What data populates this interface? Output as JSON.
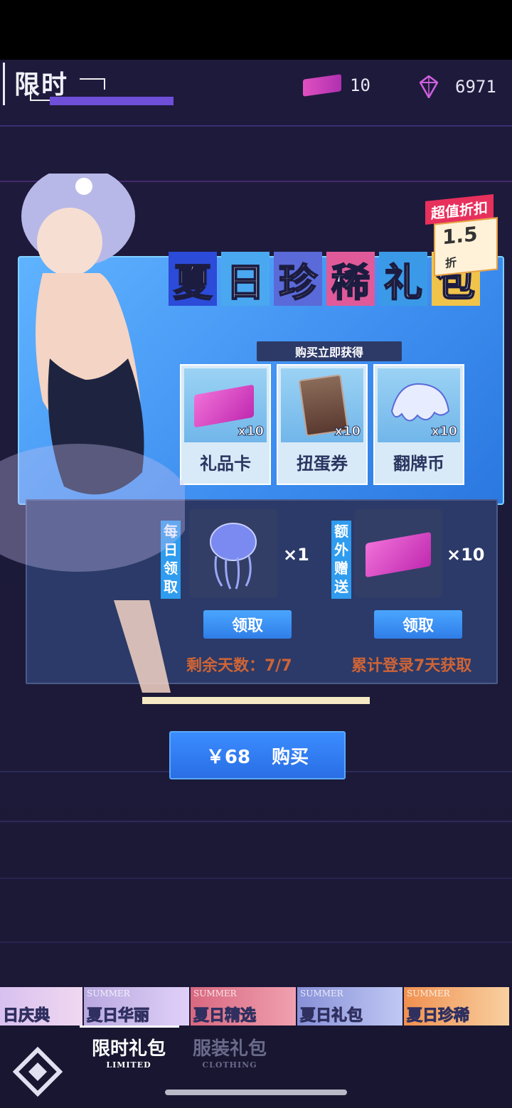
{
  "header": {
    "title": "限时",
    "currencies": [
      {
        "icon": "gift-card-icon",
        "value": "10"
      },
      {
        "icon": "crystal-icon",
        "value": "6971"
      }
    ]
  },
  "promo": {
    "discount_label": "超值折扣",
    "discount_value": "1.5",
    "discount_unit": "折"
  },
  "package": {
    "title_chars": [
      "夏",
      "日",
      "珍",
      "稀",
      "礼",
      "包"
    ],
    "title_colors": [
      "#2b4bd8",
      "#4aa8f0",
      "#5a6ad8",
      "#e05a9a",
      "#3a9ae8",
      "#f0c34a"
    ],
    "subtitle": "购买立即获得",
    "items": [
      {
        "name": "礼品卡",
        "qty": "x10",
        "icon": "gift-card-icon"
      },
      {
        "name": "扭蛋券",
        "qty": "x10",
        "icon": "gacha-ticket-icon"
      },
      {
        "name": "翻牌币",
        "qty": "x10",
        "icon": "flip-coin-creature-icon"
      }
    ]
  },
  "daily": {
    "tag": "每日领取",
    "qty": "×1",
    "icon": "jellyfish-icon",
    "claim_label": "领取",
    "note": "剩余天数：7/7"
  },
  "bonus": {
    "tag": "额外赠送",
    "qty": "×10",
    "icon": "gift-card-icon",
    "claim_label": "领取",
    "note": "累计登录7天获取"
  },
  "purchase": {
    "price": "￥68",
    "label": "购买"
  },
  "banners": [
    {
      "en": "",
      "zh": "日庆典",
      "color": "#e8c8e8"
    },
    {
      "en": "SUMMER",
      "zh": "夏日华丽",
      "color": "#c8b8e8"
    },
    {
      "en": "SUMMER",
      "zh": "夏日精选",
      "color": "#e87890"
    },
    {
      "en": "SUMMER",
      "zh": "夏日礼包",
      "color": "#a8b0e8"
    },
    {
      "en": "SUMMER",
      "zh": "夏日珍稀",
      "color": "#f4a060"
    }
  ],
  "nav": {
    "tabs": [
      {
        "zh": "限时礼包",
        "en": "LIMITED",
        "active": true
      },
      {
        "zh": "服装礼包",
        "en": "CLOTHING",
        "active": false
      }
    ]
  }
}
